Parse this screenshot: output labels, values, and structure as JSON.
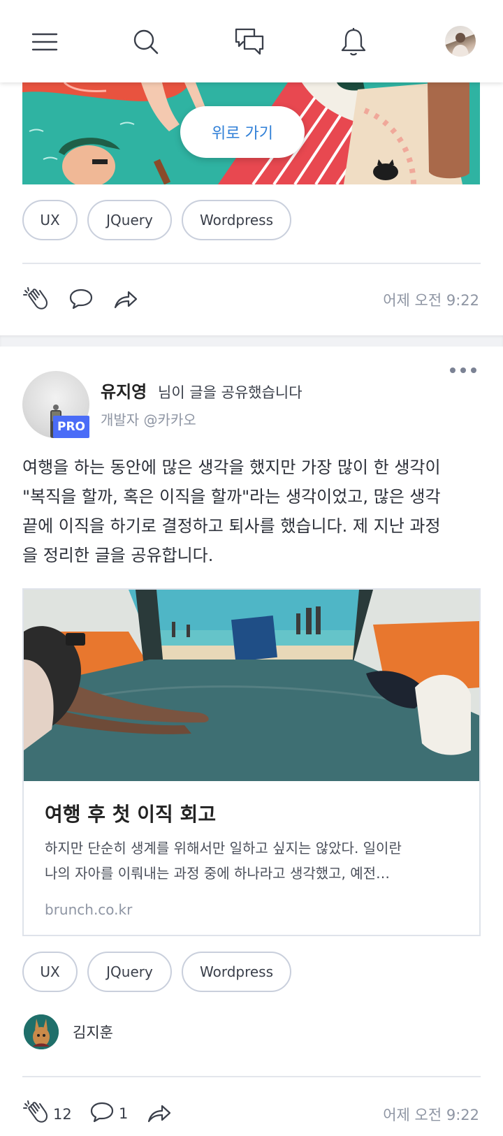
{
  "header": {
    "icons": [
      "menu-icon",
      "search-icon",
      "messages-icon",
      "bell-icon"
    ]
  },
  "card1": {
    "scroll_top_label": "위로 가기",
    "tags": [
      "UX",
      "JQuery",
      "Wordpress"
    ],
    "time": "어제 오전 9:22"
  },
  "post": {
    "author": "유지영",
    "shared_text": "님이 글을 공유했습니다",
    "subtitle": "개발자 @카카오",
    "badge": "PRO",
    "body_lines": [
      "여행을 하는 동안에 많은 생각을 했지만 가장 많이 한 생각이",
      "\"복직을 할까, 혹은 이직을 할까\"라는 생각이었고, 많은 생각",
      "끝에 이직을 하기로 결정하고 퇴사를 했습니다. 제 지난 과정",
      "을 정리한 글을 공유합니다."
    ],
    "link": {
      "title": "여행 후 첫 이직 회고",
      "desc_lines": [
        "하지만 단순히 생계를 위해서만 일하고 싶지는 않았다. 일이란",
        "나의 자아를 이뤄내는 과정 중에 하나라고 생각했고, 예전…"
      ],
      "url": "brunch.co.kr"
    },
    "tags": [
      "UX",
      "JQuery",
      "Wordpress"
    ],
    "liker_name": "김지훈",
    "clap_count": "12",
    "comment_count": "1",
    "time": "어제 오전 9:22"
  }
}
